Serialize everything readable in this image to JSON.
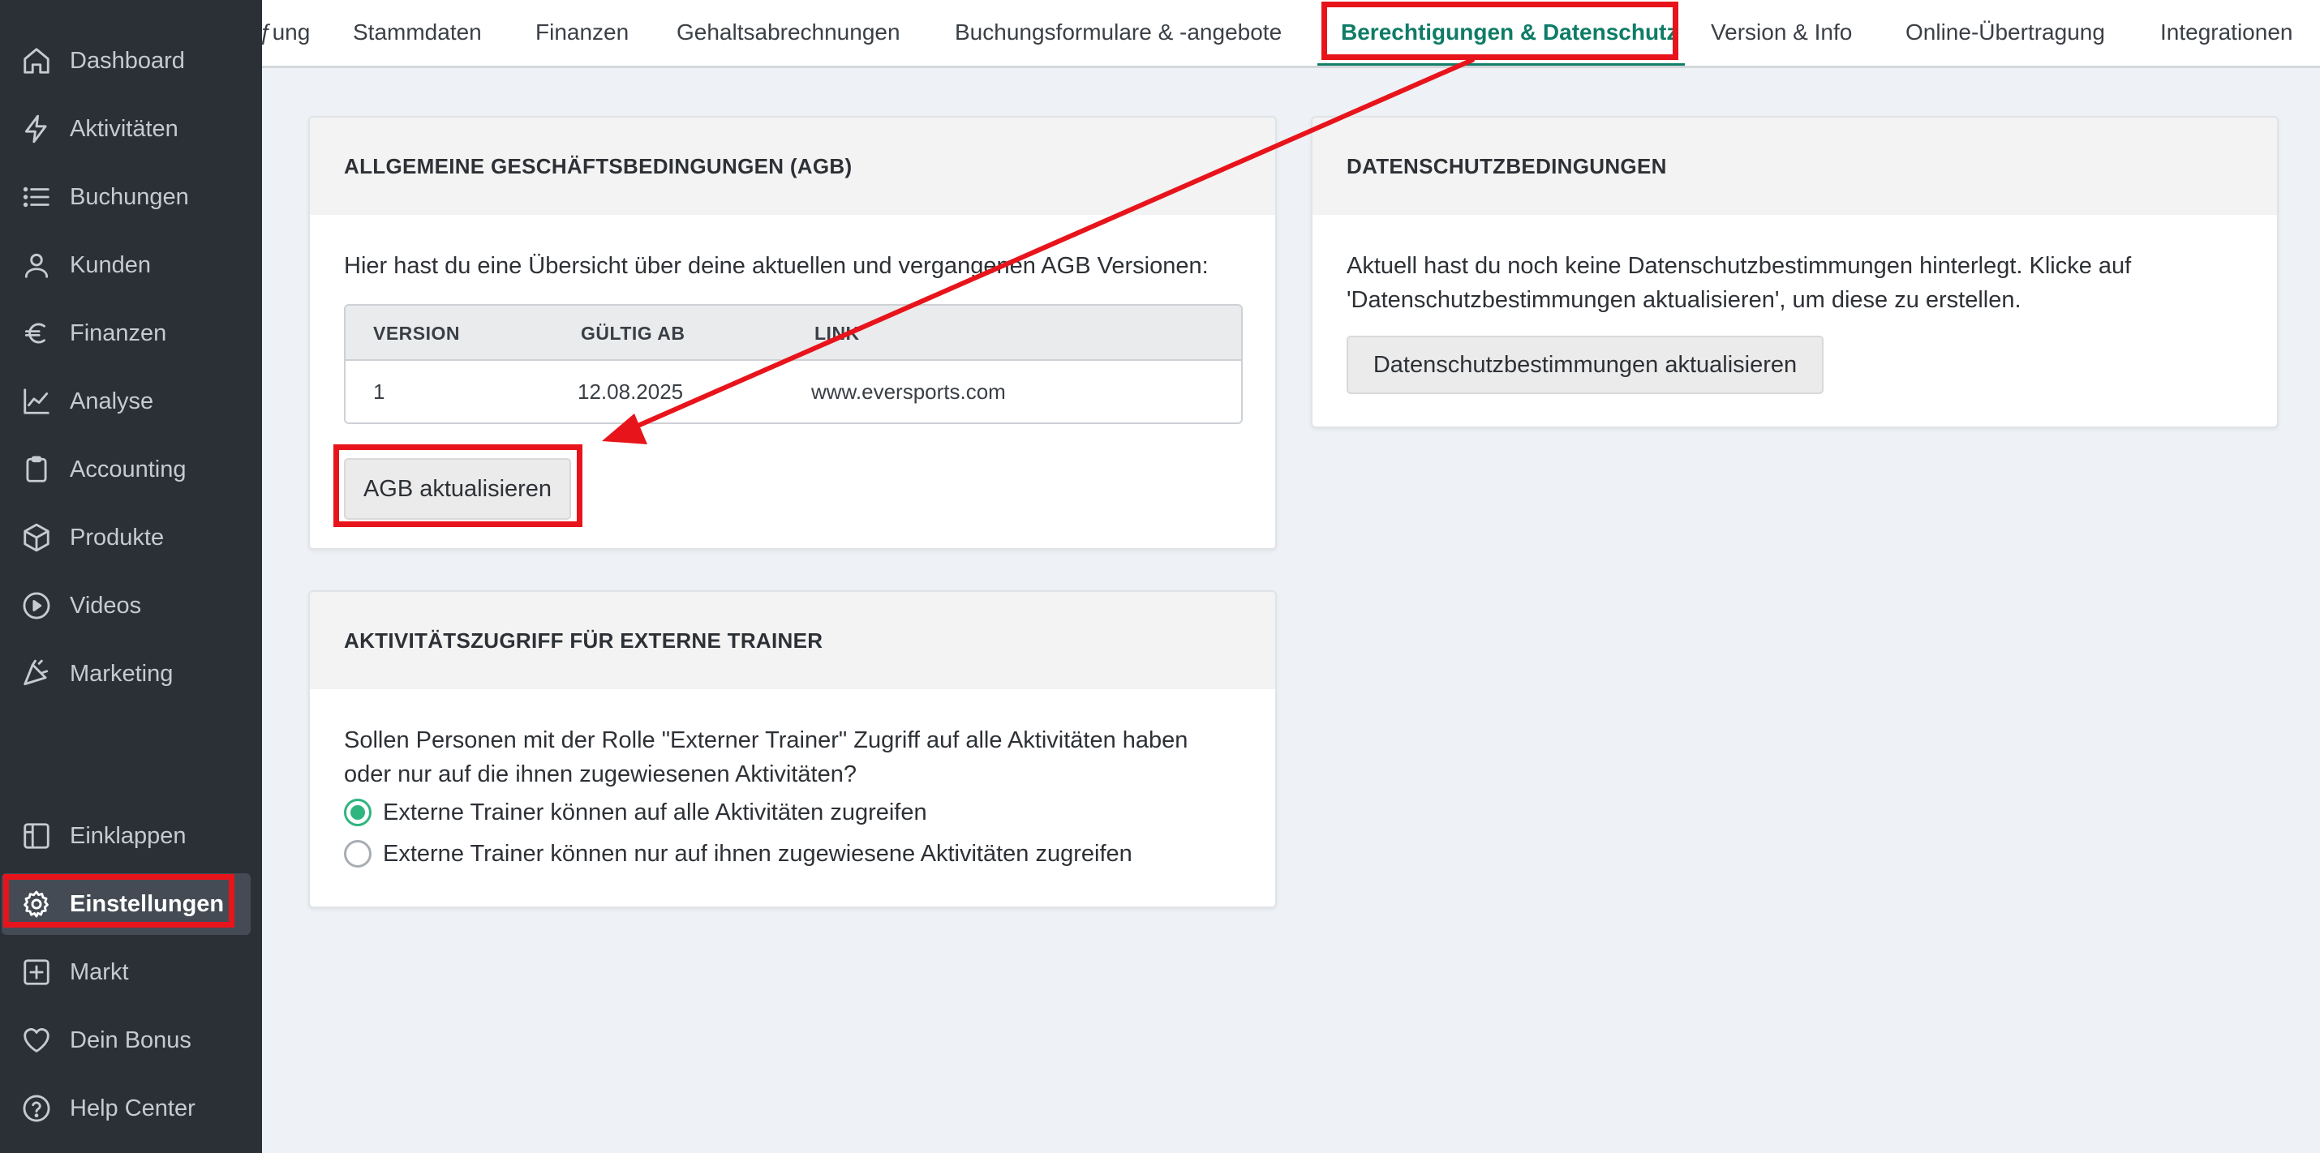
{
  "sidebar": {
    "items": [
      {
        "label": "Dashboard",
        "icon": "home-icon"
      },
      {
        "label": "Aktivitäten",
        "icon": "lightning-icon"
      },
      {
        "label": "Buchungen",
        "icon": "list-icon"
      },
      {
        "label": "Kunden",
        "icon": "user-icon"
      },
      {
        "label": "Finanzen",
        "icon": "euro-icon"
      },
      {
        "label": "Analyse",
        "icon": "chart-line-icon"
      },
      {
        "label": "Accounting",
        "icon": "clipboard-icon"
      },
      {
        "label": "Produkte",
        "icon": "box-icon"
      },
      {
        "label": "Videos",
        "icon": "play-circle-icon"
      },
      {
        "label": "Marketing",
        "icon": "megaphone-icon"
      }
    ],
    "bottom_items": [
      {
        "label": "Einklappen",
        "icon": "collapse-icon"
      },
      {
        "label": "Einstellungen",
        "icon": "gear-icon",
        "active": true
      },
      {
        "label": "Markt",
        "icon": "plus-square-icon"
      },
      {
        "label": "Dein Bonus",
        "icon": "heart-icon"
      },
      {
        "label": "Help Center",
        "icon": "help-circle-icon"
      }
    ]
  },
  "tabs": [
    {
      "label": "ƒung"
    },
    {
      "label": "Stammdaten"
    },
    {
      "label": "Finanzen"
    },
    {
      "label": "Gehaltsabrechnungen"
    },
    {
      "label": "Buchungsformulare & -angebote"
    },
    {
      "label": "Berechtigungen & Datenschutz",
      "active": true
    },
    {
      "label": "Version & Info"
    },
    {
      "label": "Online-Übertragung"
    },
    {
      "label": "Integrationen"
    }
  ],
  "agb": {
    "title": "ALLGEMEINE GESCHÄFTSBEDINGUNGEN (AGB)",
    "intro": "Hier hast du eine Übersicht über deine aktuellen und vergangenen AGB Versionen:",
    "columns": [
      "VERSION",
      "GÜLTIG AB",
      "LINK"
    ],
    "rows": [
      [
        "1",
        "12.08.2025",
        "www.eversports.com"
      ]
    ],
    "button": "AGB aktualisieren"
  },
  "datenschutz": {
    "title": "DATENSCHUTZBEDINGUNGEN",
    "text_line1": "Aktuell hast du noch keine Datenschutzbestimmungen hinterlegt. Klicke auf",
    "text_line2": "'Datenschutzbestimmungen aktualisieren', um diese zu erstellen.",
    "button": "Datenschutzbestimmungen aktualisieren"
  },
  "trainer": {
    "title": "AKTIVITÄTSZUGRIFF FÜR EXTERNE TRAINER",
    "question_line1": "Sollen Personen mit der Rolle \"Externer Trainer\" Zugriff auf alle Aktivitäten haben",
    "question_line2": "oder nur auf die ihnen zugewiesenen Aktivitäten?",
    "options": [
      {
        "label": "Externe Trainer können auf alle Aktivitäten zugreifen",
        "checked": true
      },
      {
        "label": "Externe Trainer können nur auf ihnen zugewiesene Aktivitäten zugreifen",
        "checked": false
      }
    ]
  },
  "colors": {
    "sidebar_bg": "#2b3037",
    "accent_green": "#0e7c66",
    "radio_green": "#2fb57f",
    "highlight_red": "#e8141b"
  }
}
